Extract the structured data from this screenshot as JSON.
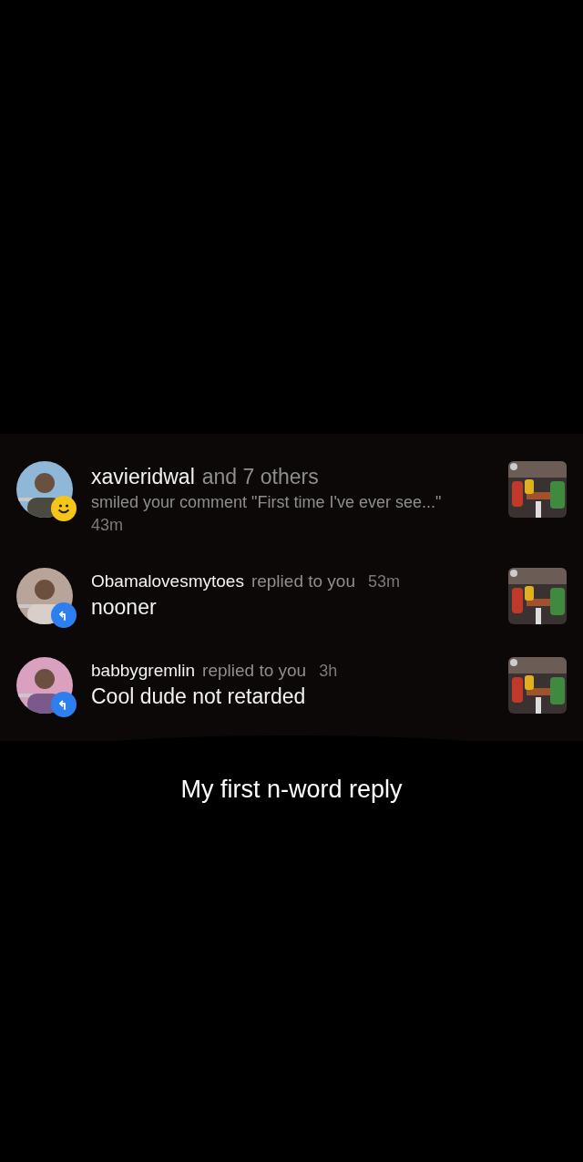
{
  "notifications": [
    {
      "kind": "reaction",
      "user": "xavieridwal",
      "action": "and 7 others",
      "detail": "smiled your comment \"First time I've ever see...\"",
      "time": "43m"
    },
    {
      "kind": "reply",
      "user": "Obamalovesmytoes",
      "action": "replied to you",
      "time": "53m",
      "body": "nooner"
    },
    {
      "kind": "reply",
      "user": "babbygremlin",
      "action": "replied to you",
      "time": "3h",
      "body": "Cool dude not retarded"
    }
  ],
  "caption": "My first n-word reply"
}
